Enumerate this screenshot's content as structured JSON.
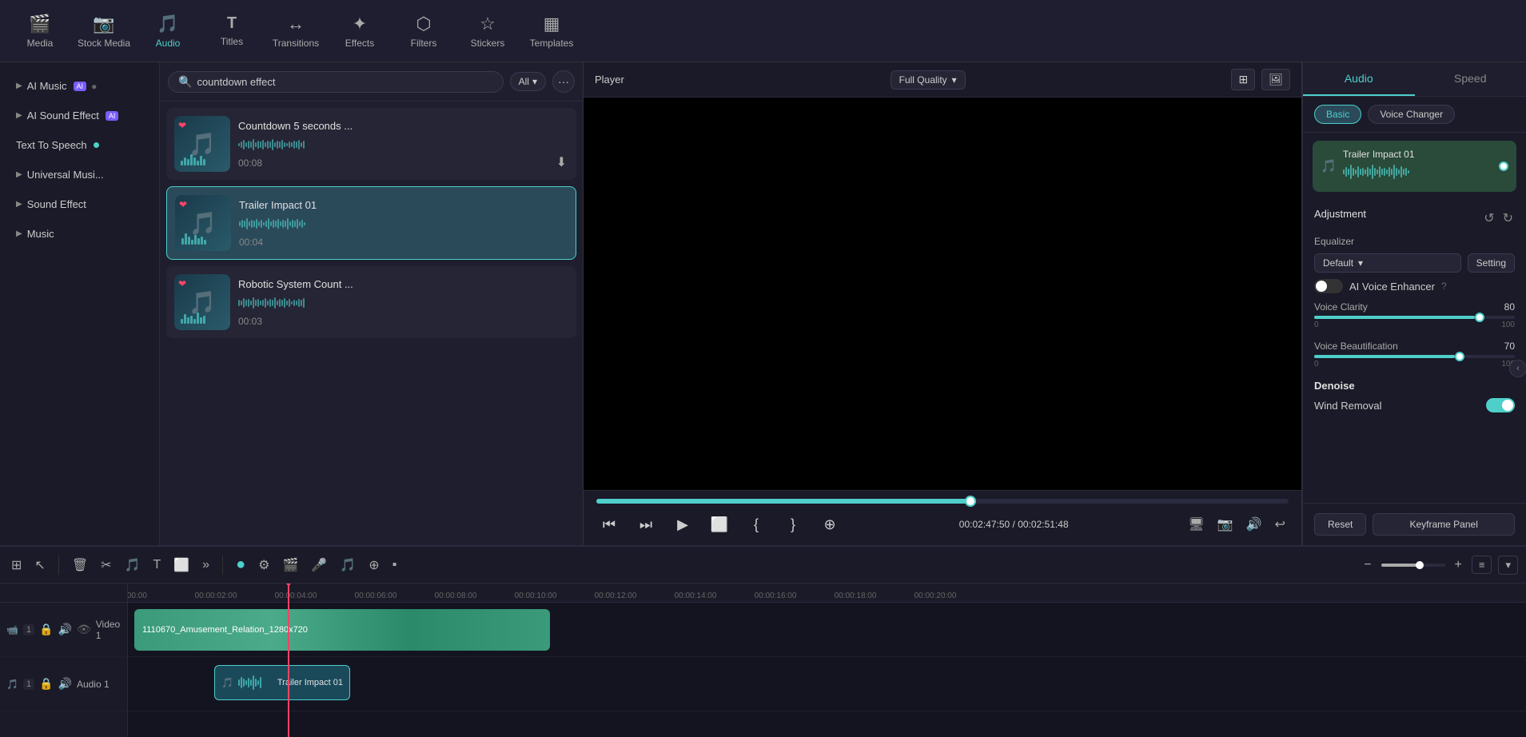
{
  "toolbar": {
    "items": [
      {
        "id": "media",
        "label": "Media",
        "icon": "🎬"
      },
      {
        "id": "stock",
        "label": "Stock Media",
        "icon": "📷"
      },
      {
        "id": "audio",
        "label": "Audio",
        "icon": "🎵"
      },
      {
        "id": "titles",
        "label": "Titles",
        "icon": "T"
      },
      {
        "id": "transitions",
        "label": "Transitions",
        "icon": "↔"
      },
      {
        "id": "effects",
        "label": "Effects",
        "icon": "✦"
      },
      {
        "id": "filters",
        "label": "Filters",
        "icon": "⬡"
      },
      {
        "id": "stickers",
        "label": "Stickers",
        "icon": "☆"
      },
      {
        "id": "templates",
        "label": "Templates",
        "icon": "▦"
      }
    ]
  },
  "sidebar": {
    "items": [
      {
        "id": "ai-music",
        "label": "AI Music",
        "badge": "AI",
        "hasBadge": true
      },
      {
        "id": "ai-sound",
        "label": "AI Sound Effect",
        "badge": "AI",
        "hasBadge": true
      },
      {
        "id": "tts",
        "label": "Text To Speech",
        "hasDot": true
      },
      {
        "id": "universal",
        "label": "Universal Musi..."
      },
      {
        "id": "sound-effect",
        "label": "Sound Effect"
      },
      {
        "id": "music",
        "label": "Music"
      }
    ]
  },
  "search": {
    "placeholder": "countdown effect",
    "filter_label": "All",
    "filter_icon": "▾"
  },
  "audio_items": [
    {
      "id": "countdown",
      "title": "Countdown 5 seconds ...",
      "duration": "00:08",
      "has_heart": true,
      "has_download": true
    },
    {
      "id": "trailer",
      "title": "Trailer Impact 01",
      "duration": "00:04",
      "has_heart": true,
      "selected": true
    },
    {
      "id": "robotic",
      "title": "Robotic System Count ...",
      "duration": "00:03",
      "has_heart": true
    }
  ],
  "player": {
    "label": "Player",
    "quality": "Full Quality",
    "current_time": "00:02:47:50",
    "total_time": "00:02:51:48",
    "progress_pct": 54
  },
  "right_panel": {
    "tabs": [
      "Audio",
      "Speed"
    ],
    "active_tab": "Audio",
    "subtabs": [
      "Basic",
      "Voice Changer"
    ],
    "active_subtab": "Basic",
    "active_track": "Trailer Impact 01",
    "adjustment_label": "Adjustment",
    "equalizer_label": "Equalizer",
    "equalizer_value": "Default",
    "setting_btn": "Setting",
    "ai_voice_enhancer": "AI Voice Enhancer",
    "voice_clarity": {
      "label": "Voice Clarity",
      "value": 80,
      "min": 0,
      "max": 100,
      "fill_pct": 80
    },
    "voice_beautification": {
      "label": "Voice Beautification",
      "value": 70,
      "min": 0,
      "max": 100,
      "fill_pct": 70
    },
    "denoise_label": "Denoise",
    "wind_removal": "Wind Removal",
    "reset_btn": "Reset",
    "keyframe_btn": "Keyframe Panel"
  },
  "timeline": {
    "ruler_marks": [
      "00:00",
      "00:00:02:00",
      "00:00:04:00",
      "00:00:06:00",
      "00:00:08:00",
      "00:00:10:00",
      "00:00:12:00",
      "00:00:14:00",
      "00:00:16:00",
      "00:00:18:00",
      "00:00:20:00"
    ],
    "video_track_label": "Video 1",
    "audio_track_label": "Audio 1",
    "video_clip_label": "1110670_Amusement_Relation_1280x720",
    "audio_clip_label": "Trailer Impact 01"
  },
  "colors": {
    "accent": "#4ecfca",
    "brand_green": "#2a8a6a",
    "selected_bg": "#2a4a5a"
  }
}
